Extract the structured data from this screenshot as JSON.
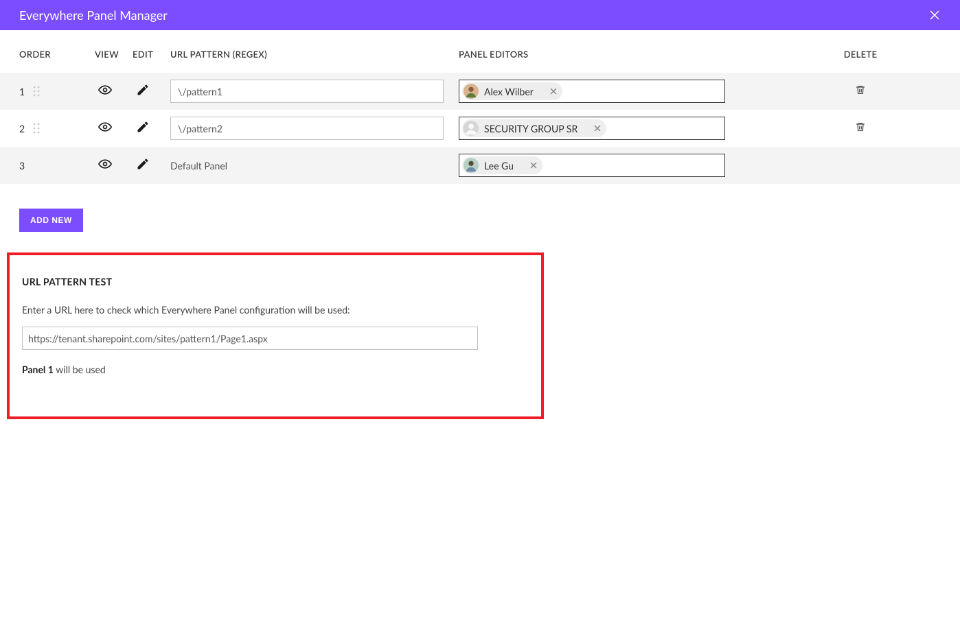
{
  "header": {
    "title": "Everywhere Panel Manager"
  },
  "columns": {
    "order": "ORDER",
    "view": "VIEW",
    "edit": "EDIT",
    "url_pattern": "URL PATTERN (REGEX)",
    "panel_editors": "PANEL EDITORS",
    "delete": "DELETE"
  },
  "rows": [
    {
      "order": "1",
      "has_drag": true,
      "pattern_value": "\\/pattern1",
      "pattern_is_input": true,
      "editor": {
        "name": "Alex Wilber",
        "avatar": "person1"
      },
      "deletable": true
    },
    {
      "order": "2",
      "has_drag": true,
      "pattern_value": "\\/pattern2",
      "pattern_is_input": true,
      "editor": {
        "name": "SECURITY GROUP SR",
        "avatar": "group"
      },
      "deletable": true
    },
    {
      "order": "3",
      "has_drag": false,
      "pattern_value": "Default Panel",
      "pattern_is_input": false,
      "editor": {
        "name": "Lee Gu",
        "avatar": "person2"
      },
      "deletable": false
    }
  ],
  "add_button": "ADD NEW",
  "test": {
    "title": "URL PATTERN TEST",
    "description": "Enter a URL here to check which Everywhere Panel configuration will be used:",
    "input_value": "https://tenant.sharepoint.com/sites/pattern1/Page1.aspx",
    "result_bold": "Panel 1",
    "result_rest": " will be used"
  },
  "colors": {
    "accent": "#7b4dff",
    "highlight_border": "#ee1c25"
  }
}
